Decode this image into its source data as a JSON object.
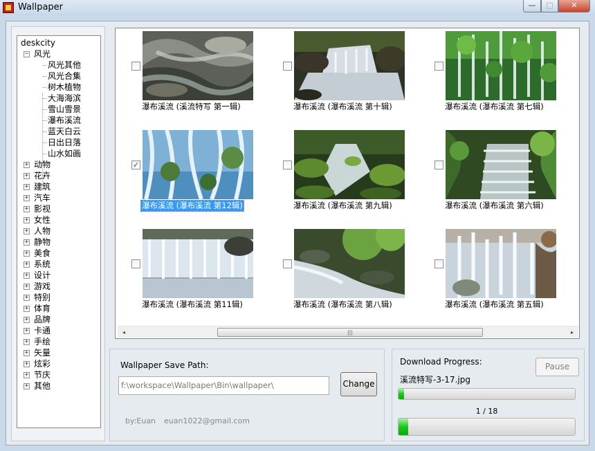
{
  "window": {
    "title": "Wallpaper",
    "minimize_glyph": "—",
    "maximize_glyph": "□",
    "close_glyph": "✕"
  },
  "tree": {
    "root": "deskcity",
    "expanded": {
      "label": "风光",
      "children": [
        "风光其他",
        "风光合集",
        "树木植物",
        "大海海滨",
        "雪山雪景",
        "瀑布溪流",
        "蓝天白云",
        "日出日落",
        "山水如画"
      ]
    },
    "categories": [
      "动物",
      "花卉",
      "建筑",
      "汽车",
      "影视",
      "女性",
      "人物",
      "静物",
      "美食",
      "系统",
      "设计",
      "游戏",
      "特别",
      "体育",
      "品牌",
      "卡通",
      "手绘",
      "矢量",
      "炫彩",
      "节庆",
      "其他"
    ]
  },
  "gallery": {
    "items": [
      {
        "caption": "瀑布溪流 (溪流特写 第一辑)",
        "checked": false,
        "selected": false,
        "scene": "rocks"
      },
      {
        "caption": "瀑布溪流 (瀑布溪流 第十辑)",
        "checked": false,
        "selected": false,
        "scene": "cascade"
      },
      {
        "caption": "瀑布溪流 (瀑布溪流 第七辑)",
        "checked": false,
        "selected": false,
        "scene": "green-falls"
      },
      {
        "caption": "瀑布溪流 (瀑布溪流 第12辑)",
        "checked": true,
        "selected": true,
        "scene": "blue-falls"
      },
      {
        "caption": "瀑布溪流 (瀑布溪流 第九辑)",
        "checked": false,
        "selected": false,
        "scene": "mossy-stream"
      },
      {
        "caption": "瀑布溪流 (瀑布溪流 第六辑)",
        "checked": false,
        "selected": false,
        "scene": "steps"
      },
      {
        "caption": "瀑布溪流 (瀑布溪流 第11辑)",
        "checked": false,
        "selected": false,
        "scene": "wide-falls"
      },
      {
        "caption": "瀑布溪流 (瀑布溪流 第八辑)",
        "checked": false,
        "selected": false,
        "scene": "forest-stream"
      },
      {
        "caption": "瀑布溪流 (瀑布溪流 第五辑)",
        "checked": false,
        "selected": false,
        "scene": "white-falls"
      }
    ],
    "check_glyph": "✓",
    "scroll_left_glyph": "◂",
    "scroll_right_glyph": "▸",
    "scroll_grip_glyph": "|||"
  },
  "save_path": {
    "label": "Wallpaper Save Path:",
    "value": "f:\\workspace\\Wallpaper\\Bin\\wallpaper\\",
    "change_label": "Change",
    "author": "by:Euan",
    "email": "euan1022@gmail.com"
  },
  "download": {
    "label": "Download Progress:",
    "pause_label": "Pause",
    "pause_enabled": false,
    "current_file": "溪流特写-3-17.jpg",
    "file_progress": 0.03,
    "count_text": "1 / 18",
    "completed": 1,
    "total": 18
  },
  "colors": {
    "selection": "#3399ff",
    "progress_green": "#20c520",
    "window_frame": "#c9d9ea"
  }
}
